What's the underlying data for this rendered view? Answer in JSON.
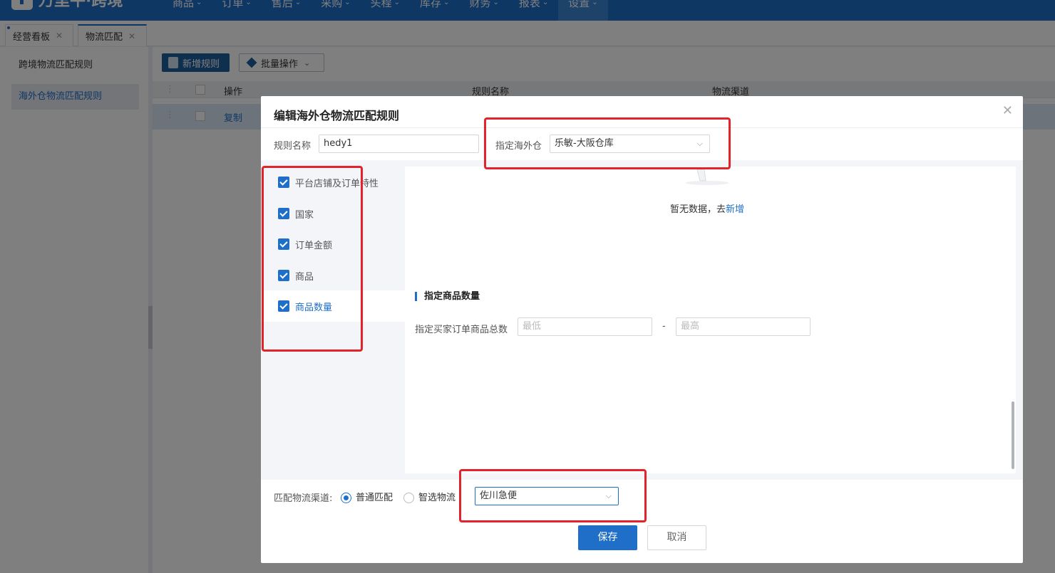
{
  "app": {
    "logo_text": "万里牛·跨境"
  },
  "nav": {
    "items": [
      "商品",
      "订单",
      "售后",
      "采购",
      "头程",
      "库存",
      "财务",
      "报表",
      "设置"
    ],
    "active_index": 8
  },
  "tabs": [
    {
      "label": "经营看板"
    },
    {
      "label": "物流匹配"
    }
  ],
  "sidebar": {
    "items": [
      "跨境物流匹配规则",
      "海外仓物流匹配规则"
    ],
    "active_index": 1
  },
  "toolbar": {
    "add_label": "新增规则",
    "batch_label": "批量操作"
  },
  "table": {
    "columns": [
      "操作",
      "规则名称",
      "物流渠道"
    ],
    "rows": [
      {
        "action": "复制"
      }
    ]
  },
  "dialog": {
    "title": "编辑海外仓物流匹配规则",
    "rule_name_label": "规则名称",
    "rule_name_value": "hedy1",
    "warehouse_label": "指定海外仓",
    "warehouse_value": "乐敏-大阪仓库",
    "conditions": [
      "平台店铺及订单特性",
      "国家",
      "订单金额",
      "商品",
      "商品数量"
    ],
    "active_condition_index": 4,
    "empty_text": "暂无数据，去",
    "empty_link": "新增",
    "section_title": "指定商品数量",
    "qty_label": "指定买家订单商品总数",
    "qty_min_placeholder": "最低",
    "qty_dash": "-",
    "qty_max_placeholder": "最高",
    "match_label": "匹配物流渠道:",
    "match_options": [
      "普通匹配",
      "智选物流"
    ],
    "match_selected_index": 0,
    "channel_value": "佐川急便",
    "save_label": "保存",
    "cancel_label": "取消"
  },
  "colors": {
    "brand": "#1f6fc8",
    "highlight_box": "#e3232c"
  }
}
